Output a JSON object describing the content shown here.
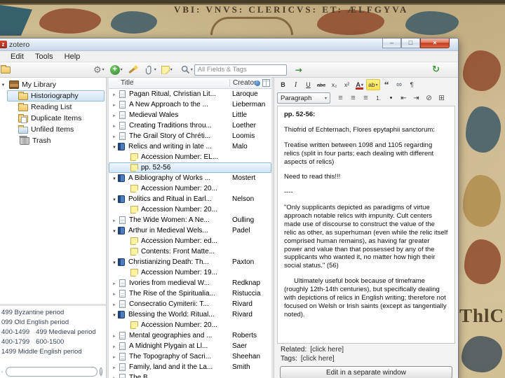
{
  "background": {
    "caption": "VBI: VNVS: CLERICVS: ET: ÆLFGYVA",
    "side_text": "ThlC"
  },
  "window": {
    "title": "zotero",
    "controls": [
      {
        "name": "minimize-button",
        "glyph": "–",
        "icon": "min"
      },
      {
        "name": "maximize-button",
        "glyph": "□",
        "icon": "max"
      },
      {
        "name": "close-button",
        "glyph": "×",
        "icon": "close"
      }
    ]
  },
  "menu": {
    "items": [
      {
        "name": "menu-edit",
        "label": "Edit"
      },
      {
        "name": "menu-tools",
        "label": "Tools"
      },
      {
        "name": "menu-help",
        "label": "Help"
      }
    ]
  },
  "toolbar": {
    "search_placeholder": "All Fields & Tags",
    "icons": [
      "new-collection",
      "actions-gear",
      "new-item",
      "add-by-identifier-wand",
      "new-attachment-paperclip",
      "new-note",
      "search-scope-magnifier",
      "locate-arrow",
      "sync-arrows"
    ]
  },
  "collections": {
    "items": [
      {
        "name": "collection-my-library",
        "icon": "library",
        "twisty": "open",
        "label": "My Library",
        "level": 0
      },
      {
        "name": "collection-historiography",
        "icon": "folder",
        "label": "Historiography",
        "level": 1,
        "selected": true
      },
      {
        "name": "collection-reading-list",
        "icon": "folder",
        "label": "Reading List",
        "level": 1
      },
      {
        "name": "collection-duplicate-items",
        "icon": "duplicates",
        "label": "Duplicate Items",
        "level": 1
      },
      {
        "name": "collection-unfiled-items",
        "icon": "unfiled",
        "label": "Unfiled Items",
        "level": 1
      },
      {
        "name": "collection-trash",
        "icon": "trash",
        "label": "Trash",
        "level": 1
      }
    ]
  },
  "tags": {
    "items": [
      {
        "text": "499 Byzantine period"
      },
      {
        "text": "099 Old English period"
      },
      {
        "text": "400-1499"
      },
      {
        "text": "499 Medieval period"
      },
      {
        "text": "400-1799"
      },
      {
        "text": "600-1500"
      },
      {
        "text": "1499 Middle English period"
      }
    ]
  },
  "items": {
    "columns": [
      "Title",
      "Creator"
    ],
    "header_icons": [
      "attachment-column",
      "column-picker"
    ],
    "rows": [
      {
        "twisty": "closed",
        "icon": "doc",
        "title": "Pagan Ritual, Christian Lit...",
        "creator": "Laroque",
        "level": 0
      },
      {
        "twisty": "closed",
        "icon": "doc",
        "title": "A New Approach to the ...",
        "creator": "Lieberman",
        "level": 0
      },
      {
        "twisty": "closed",
        "icon": "doc",
        "title": "Medieval Wales",
        "creator": "Little",
        "level": 0
      },
      {
        "twisty": "closed",
        "icon": "doc",
        "title": "Creating Traditions throu...",
        "creator": "Loether",
        "level": 0
      },
      {
        "twisty": "closed",
        "icon": "doc",
        "title": "The Grail Story of Chréti...",
        "creator": "Loomis",
        "level": 0
      },
      {
        "twisty": "open",
        "icon": "book",
        "title": "Relics and writing in late ...",
        "creator": "Malo",
        "level": 0
      },
      {
        "twisty": "none",
        "icon": "note",
        "title": "Accession Number: EL...",
        "creator": "",
        "level": 1
      },
      {
        "twisty": "none",
        "icon": "note",
        "title": "pp. 52-56",
        "creator": "",
        "level": 1,
        "selected": true
      },
      {
        "twisty": "open",
        "icon": "book",
        "title": "A Bibliography of Works ...",
        "creator": "Mostert",
        "level": 0
      },
      {
        "twisty": "none",
        "icon": "note",
        "title": "Accession Number: 20...",
        "creator": "",
        "level": 1
      },
      {
        "twisty": "open",
        "icon": "book",
        "title": "Politics and Ritual in Earl...",
        "creator": "Nelson",
        "level": 0
      },
      {
        "twisty": "none",
        "icon": "note",
        "title": "Accession Number: 20...",
        "creator": "",
        "level": 1
      },
      {
        "twisty": "closed",
        "icon": "doc",
        "title": "The Wide Women: A Ne...",
        "creator": "Oulling",
        "level": 0
      },
      {
        "twisty": "open",
        "icon": "book",
        "title": "Arthur in Medieval Wels...",
        "creator": "Padel",
        "level": 0
      },
      {
        "twisty": "none",
        "icon": "note",
        "title": "Accession Number: ed...",
        "creator": "",
        "level": 1
      },
      {
        "twisty": "none",
        "icon": "note",
        "title": "Contents: Front Matte...",
        "creator": "",
        "level": 1
      },
      {
        "twisty": "open",
        "icon": "book",
        "title": "Christianizing Death: Th...",
        "creator": "Paxton",
        "level": 0
      },
      {
        "twisty": "none",
        "icon": "note",
        "title": "Accession Number: 19...",
        "creator": "",
        "level": 1
      },
      {
        "twisty": "closed",
        "icon": "doc",
        "title": "Ivories from medieval W...",
        "creator": "Redknap",
        "level": 0
      },
      {
        "twisty": "closed",
        "icon": "doc",
        "title": "The Rise of the Spiritualia...",
        "creator": "Ristuccia",
        "level": 0
      },
      {
        "twisty": "closed",
        "icon": "doc",
        "title": "Consecratio Cymiterii: T...",
        "creator": "Rivard",
        "level": 0
      },
      {
        "twisty": "open",
        "icon": "book",
        "title": "Blessing the World: Ritual...",
        "creator": "Rivard",
        "level": 0
      },
      {
        "twisty": "none",
        "icon": "note",
        "title": "Accession Number: 20...",
        "creator": "",
        "level": 1
      },
      {
        "twisty": "closed",
        "icon": "doc",
        "title": "Mental geographies and ...",
        "creator": "Roberts",
        "level": 0
      },
      {
        "twisty": "closed",
        "icon": "doc",
        "title": "A Midnight Plygain at Ll...",
        "creator": "Saer",
        "level": 0
      },
      {
        "twisty": "closed",
        "icon": "doc",
        "title": "The Topography of Sacri...",
        "creator": "Sheehan",
        "level": 0
      },
      {
        "twisty": "closed",
        "icon": "doc",
        "title": "Family, land and it the La...",
        "creator": "Smith",
        "level": 0
      },
      {
        "twisty": "closed",
        "icon": "doc",
        "title": "The B...",
        "creator": "",
        "level": 0
      }
    ]
  },
  "editor": {
    "paragraph_style": "Paragraph",
    "toolbar_row1": [
      {
        "name": "bold-button",
        "icon": "bold",
        "glyph": "B"
      },
      {
        "name": "italic-button",
        "icon": "italic",
        "glyph": "I"
      },
      {
        "name": "underline-button",
        "icon": "underline",
        "glyph": "U"
      },
      {
        "name": "strikethrough-button",
        "icon": "strike",
        "glyph": "abc"
      },
      {
        "name": "subscript-button",
        "icon": "sub",
        "glyph": "x₂"
      },
      {
        "name": "superscript-button",
        "icon": "sup",
        "glyph": "x²"
      },
      {
        "name": "font-color-button",
        "icon": "fore",
        "glyph": "A"
      },
      {
        "name": "highlight-button",
        "icon": "hilite",
        "glyph": "ab"
      },
      {
        "name": "blockquote-button",
        "icon": "quote",
        "glyph": "“"
      },
      {
        "name": "link-button",
        "icon": "link",
        "glyph": "∞"
      },
      {
        "name": "paragraph-mark-button",
        "icon": "pilcrow",
        "glyph": "¶"
      }
    ],
    "toolbar_row2": [
      {
        "name": "align-left-button",
        "icon": "al",
        "glyph": "≡"
      },
      {
        "name": "align-center-button",
        "icon": "ac",
        "glyph": "≡"
      },
      {
        "name": "align-right-button",
        "icon": "ar",
        "glyph": "≡"
      },
      {
        "name": "numbered-list-button",
        "icon": "ol",
        "glyph": "1."
      },
      {
        "name": "bullet-list-button",
        "icon": "ul",
        "glyph": "•"
      },
      {
        "name": "outdent-button",
        "icon": "outdent",
        "glyph": "⇤"
      },
      {
        "name": "indent-button",
        "icon": "indent",
        "glyph": "⇥"
      },
      {
        "name": "clear-format-button",
        "icon": "clear",
        "glyph": "⊘"
      },
      {
        "name": "table-button",
        "icon": "table",
        "glyph": "⊞"
      }
    ],
    "paragraphs": [
      {
        "text": "pp. 52-56:",
        "cls": "b"
      },
      {
        "text": "Thiofrid of Echternach, Flores epytaphii sanctorum:"
      },
      {
        "text": "Treatise written between 1098 and 1105 regarding relics (split in four parts; each dealing with different aspects of relics)"
      },
      {
        "text": "Need to read this!!!"
      },
      {
        "text": "----"
      },
      {
        "text": "\"Only supplicants depicted as paradigms of virtue approach notable relics with impunity. Cult centers made use of discourse to construct the value of the relic as other, as superhuman (even while the relic itself comprised human remains), as having far greater power and value than that possessed by any of the supplicants who wanted it, no matter how high their social status.\" (56)"
      },
      {
        "text": "Ultimately useful book because of timeframe (roughly 12th-14th centuries), but specifically dealing with depictions of relics in English writing; therefore not focused on Welsh or Irish saints (except as tangentially noted).",
        "cls": "ind"
      }
    ],
    "related_label": "Related:",
    "related_value": "[click here]",
    "tags_label": "Tags:",
    "tags_value": "[click here]",
    "edit_button_label": "Edit in a separate window"
  }
}
